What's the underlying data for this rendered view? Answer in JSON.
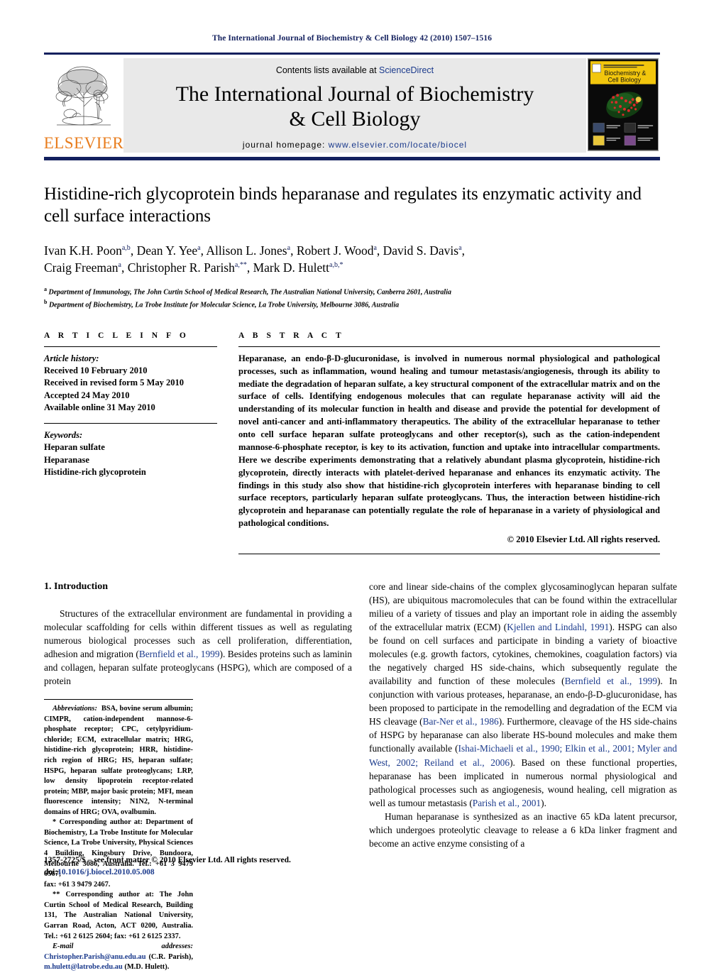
{
  "running_head": "The International Journal of Biochemistry & Cell Biology 42 (2010) 1507–1516",
  "masthead": {
    "publisher_name": "ELSEVIER",
    "publisher_logo_name": "elsevier-tree-logo",
    "contents_prefix": "Contents lists available at ",
    "contents_link": "ScienceDirect",
    "journal_title_line1": "The International Journal of Biochemistry",
    "journal_title_line2": "& Cell Biology",
    "homepage_label": "journal homepage: ",
    "homepage_url": "www.elsevier.com/locate/biocel",
    "cover_title_line1": "Biochemistry &",
    "cover_title_line2": "Cell Biology",
    "cover_kicker": "The International Journal of",
    "colors": {
      "navy": "#13205e",
      "link_blue": "#1b3a8c",
      "elsevier_orange": "#e87d1e",
      "masthead_gray": "#e9e9e9",
      "cover_yellow": "#f2c60d"
    }
  },
  "title": "Histidine-rich glycoprotein binds heparanase and regulates its enzymatic activity and cell surface interactions",
  "authors_line1_parts": [
    {
      "name": "Ivan K.H. Poon",
      "sup": "a,b"
    },
    {
      "name": "Dean Y. Yee",
      "sup": "a"
    },
    {
      "name": "Allison L. Jones",
      "sup": "a"
    },
    {
      "name": "Robert J. Wood",
      "sup": "a"
    },
    {
      "name": "David S. Davis",
      "sup": "a"
    }
  ],
  "authors_line2_parts": [
    {
      "name": "Craig Freeman",
      "sup": "a"
    },
    {
      "name": "Christopher R. Parish",
      "sup": "a,**"
    },
    {
      "name": "Mark D. Hulett",
      "sup": "a,b,*"
    }
  ],
  "affiliations": [
    {
      "mark": "a",
      "text": "Department of Immunology, The John Curtin School of Medical Research, The Australian National University, Canberra 2601, Australia"
    },
    {
      "mark": "b",
      "text": "Department of Biochemistry, La Trobe Institute for Molecular Science, La Trobe University, Melbourne 3086, Australia"
    }
  ],
  "article_info": {
    "heading": "A R T I C L E   I N F O",
    "history_label": "Article history:",
    "history": [
      "Received 10 February 2010",
      "Received in revised form 5 May 2010",
      "Accepted 24 May 2010",
      "Available online 31 May 2010"
    ],
    "keywords_label": "Keywords:",
    "keywords": [
      "Heparan sulfate",
      "Heparanase",
      "Histidine-rich glycoprotein"
    ]
  },
  "abstract": {
    "heading": "A B S T R A C T",
    "text": "Heparanase, an endo-β-D-glucuronidase, is involved in numerous normal physiological and pathological processes, such as inflammation, wound healing and tumour metastasis/angiogenesis, through its ability to mediate the degradation of heparan sulfate, a key structural component of the extracellular matrix and on the surface of cells. Identifying endogenous molecules that can regulate heparanase activity will aid the understanding of its molecular function in health and disease and provide the potential for development of novel anti-cancer and anti-inflammatory therapeutics. The ability of the extracellular heparanase to tether onto cell surface heparan sulfate proteoglycans and other receptor(s), such as the cation-independent mannose-6-phosphate receptor, is key to its activation, function and uptake into intracellular compartments. Here we describe experiments demonstrating that a relatively abundant plasma glycoprotein, histidine-rich glycoprotein, directly interacts with platelet-derived heparanase and enhances its enzymatic activity. The findings in this study also show that histidine-rich glycoprotein interferes with heparanase binding to cell surface receptors, particularly heparan sulfate proteoglycans. Thus, the interaction between histidine-rich glycoprotein and heparanase can potentially regulate the role of heparanase in a variety of physiological and pathological conditions.",
    "copyright": "© 2010 Elsevier Ltd. All rights reserved."
  },
  "introduction": {
    "heading": "1.  Introduction",
    "left_para_1": "Structures of the extracellular environment are fundamental in providing a molecular scaffolding for cells within different tissues as well as regulating numerous biological processes such as cell proliferation, differentiation, adhesion and migration (",
    "left_ref_1": "Bernfield et al., 1999",
    "left_para_1b": "). Besides proteins such as laminin and collagen, heparan sulfate proteoglycans (HSPG), which are composed of a protein",
    "right_para_1a": "core and linear side-chains of the complex glycosaminoglycan heparan sulfate (HS), are ubiquitous macromolecules that can be found within the extracellular milieu of a variety of tissues and play an important role in aiding the assembly of the extracellular matrix (ECM) (",
    "right_ref_1": "Kjellen and Lindahl, 1991",
    "right_para_1b": "). HSPG can also be found on cell surfaces and participate in binding a variety of bioactive molecules (e.g. growth factors, cytokines, chemokines, coagulation factors) via the negatively charged HS side-chains, which subsequently regulate the availability and function of these molecules (",
    "right_ref_2": "Bernfield et al., 1999",
    "right_para_1c": "). In conjunction with various proteases, heparanase, an endo-β-D-glucuronidase, has been proposed to participate in the remodelling and degradation of the ECM via HS cleavage (",
    "right_ref_3": "Bar-Ner et al., 1986",
    "right_para_1d": "). Furthermore, cleavage of the HS side-chains of HSPG by heparanase can also liberate HS-bound molecules and make them functionally available (",
    "right_ref_4": "Ishai-Michaeli et al., 1990; Elkin et al., 2001; Myler and West, 2002; Reiland et al., 2006",
    "right_para_1e": "). Based on these functional properties, heparanase has been implicated in numerous normal physiological and pathological processes such as angiogenesis, wound healing, cell migration as well as tumour metastasis (",
    "right_ref_5": "Parish et al., 2001",
    "right_para_1f": ").",
    "right_para_2a": "Human heparanase is synthesized as an inactive 65 kDa latent precursor, which undergoes proteolytic cleavage to release a 6 kDa linker fragment and become an active enzyme consisting of a"
  },
  "footnotes": {
    "abbrev_label": "Abbreviations:",
    "abbrev_text": "BSA, bovine serum albumin; CIMPR, cation-independent mannose-6-phosphate receptor; CPC, cetylpyridium-chloride; ECM, extracellular matrix; HRG, histidine-rich glycoprotein; HRR, histidine-rich region of HRG; HS, heparan sulfate; HSPG, heparan sulfate proteoglycans; LRP, low density lipoprotein receptor-related protein; MBP, major basic protein; MFI, mean fluorescence intensity; N1N2, N-terminal domains of HRG; OVA, ovalbumin.",
    "corr1_mark": "*",
    "corr1_text": "Corresponding author at: Department of Biochemistry, La Trobe Institute for Molecular Science, La Trobe University, Physical Sciences 4 Building, Kingsbury Drive, Bundoora, Melbourne 3086, Australia. Tel.: +61 3 9479 6567;",
    "corr1_text2": "fax: +61 3 9479 2467.",
    "corr2_mark": "**",
    "corr2_text": "Corresponding author at: The John Curtin School of Medical Research, Building 131, The Australian National University, Garran Road, Acton, ACT 0200, Australia. Tel.: +61 2 6125 2604; fax: +61 2 6125 2337.",
    "email_label": "E-mail addresses:",
    "email1": "Christopher.Parish@anu.edu.au",
    "email1_owner": "(C.R. Parish),",
    "email2": "m.hulett@latrobe.edu.au",
    "email2_owner": "(M.D. Hulett)."
  },
  "bottom": {
    "issn_line": "1357-2725/$ – see front matter © 2010 Elsevier Ltd. All rights reserved.",
    "doi_label": "doi:",
    "doi_value": "10.1016/j.biocel.2010.05.008"
  }
}
